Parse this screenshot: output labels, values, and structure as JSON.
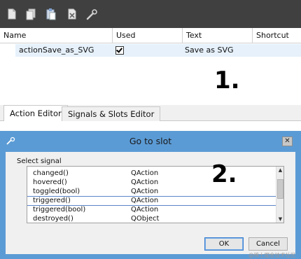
{
  "toolbar": {
    "icons": [
      "new-document-icon",
      "copy-icon",
      "paste-icon",
      "delete-icon",
      "configure-icon"
    ]
  },
  "table": {
    "columns": [
      "Name",
      "Used",
      "Text",
      "Shortcut"
    ],
    "rows": [
      {
        "name": "actionSave_as_SVG",
        "used": true,
        "text": "Save as SVG",
        "shortcut": ""
      }
    ]
  },
  "annotations": {
    "step1": "1.",
    "step2": "2."
  },
  "tabs": [
    {
      "label": "Action Editor",
      "active": true
    },
    {
      "label": "Signals & Slots Editor",
      "active": false
    }
  ],
  "dialog": {
    "title": "Go to slot",
    "close_glyph": "✕",
    "select_label": "Select signal",
    "signals": [
      {
        "signal": "changed()",
        "class": "QAction",
        "selected": false
      },
      {
        "signal": "hovered()",
        "class": "QAction",
        "selected": false
      },
      {
        "signal": "toggled(bool)",
        "class": "QAction",
        "selected": false
      },
      {
        "signal": "triggered()",
        "class": "QAction",
        "selected": true
      },
      {
        "signal": "triggered(bool)",
        "class": "QAction",
        "selected": false
      },
      {
        "signal": "destroyed()",
        "class": "QObject",
        "selected": false
      }
    ],
    "ok_label": "OK",
    "cancel_label": "Cancel"
  },
  "watermark": "@稀土掘金技术社区",
  "colors": {
    "toolbar": "#404040",
    "selection": "#e6f1fb",
    "dialog_frame": "#5b9bd5",
    "dialog_body": "#f0f0f0"
  }
}
